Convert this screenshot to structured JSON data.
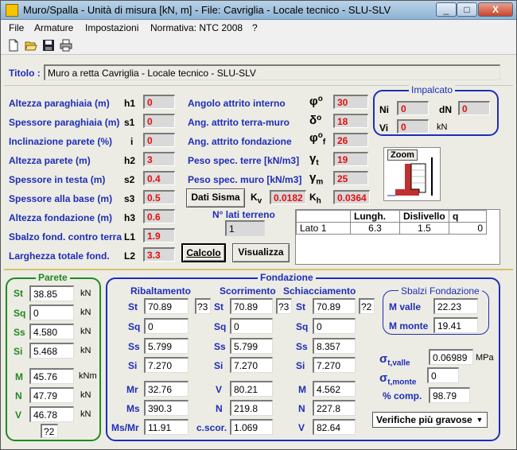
{
  "window": {
    "title": "Muro/Spalla - Unità di misura [kN, m] - File: Cavriglia - Locale tecnico - SLU-SLV",
    "min": "_",
    "max": "□",
    "close": "X"
  },
  "menu": {
    "file": "File",
    "armature": "Armature",
    "impostazioni": "Impostazioni",
    "normativa": "Normativa: NTC 2008",
    "help": "?"
  },
  "toolbar": {
    "icons": [
      "new-icon",
      "open-icon",
      "save-icon",
      "print-icon"
    ]
  },
  "titolo": {
    "label": "Titolo :",
    "value": "Muro a retta Cavriglia - Locale tecnico - SLU-SLV"
  },
  "geom": [
    {
      "label": "Altezza paraghiaia (m)",
      "sym": "h1",
      "value": "0"
    },
    {
      "label": "Spessore paraghiaia (m)",
      "sym": "s1",
      "value": "0"
    },
    {
      "label": "Inclinazione parete (%)",
      "sym": "i",
      "value": "0"
    },
    {
      "label": "Altezza parete (m)",
      "sym": "h2",
      "value": "3"
    },
    {
      "label": "Spessore in testa (m)",
      "sym": "s2",
      "value": "0.4"
    },
    {
      "label": "Spessore alla base (m)",
      "sym": "s3",
      "value": "0.5"
    },
    {
      "label": "Altezza fondazione (m)",
      "sym": "h3",
      "value": "0.6"
    },
    {
      "label": "Sbalzo fond. contro terra",
      "sym": "L1",
      "value": "1.9"
    },
    {
      "label": "Larghezza totale fond.",
      "sym": "L2",
      "value": "3.3"
    }
  ],
  "soil": [
    {
      "label": "Angolo attrito interno",
      "sym": "φ",
      "sup": "o",
      "sub": "",
      "value": "30"
    },
    {
      "label": "Ang. attrito terra-muro",
      "sym": "δ",
      "sup": "o",
      "sub": "",
      "value": "18"
    },
    {
      "label": "Ang. attrito fondazione",
      "sym": "φ",
      "sup": "o",
      "sub": "f",
      "value": "26"
    },
    {
      "label": "Peso spec. terre [kN/m3]",
      "sym": "γ",
      "sup": "",
      "sub": "t",
      "value": "19"
    },
    {
      "label": "Peso spec. muro [kN/m3]",
      "sym": "γ",
      "sup": "",
      "sub": "m",
      "value": "25"
    }
  ],
  "sisma": {
    "button": "Dati Sisma",
    "kv_label": "K",
    "kv_sub": "v",
    "kv": "0.0182",
    "kh_label": "K",
    "kh_sub": "h",
    "kh": "0.0364"
  },
  "impalcato": {
    "title": "Impalcato",
    "ni_label": "Ni",
    "ni": "0",
    "dn_label": "dN",
    "dn": "0",
    "vi_label": "Vi",
    "vi": "0",
    "unit": "kN"
  },
  "zoom": {
    "label": "Zoom"
  },
  "lati": {
    "label": "N° lati terreno",
    "value": "1",
    "headers": [
      "",
      "Lungh.",
      "Dislivello",
      "q"
    ],
    "row": [
      "Lato 1",
      "6.3",
      "1.5",
      "0"
    ]
  },
  "buttons": {
    "calcolo": "Calcolo",
    "visualizza": "Visualizza"
  },
  "parete": {
    "title": "Parete",
    "rows": [
      {
        "label": "St",
        "value": "38.85",
        "unit": "kN"
      },
      {
        "label": "Sq",
        "value": "0",
        "unit": "kN"
      },
      {
        "label": "Ss",
        "value": "4.580",
        "unit": "kN"
      },
      {
        "label": "Si",
        "value": "5.468",
        "unit": "kN"
      },
      {
        "label": "M",
        "value": "45.76",
        "unit": "kNm"
      },
      {
        "label": "N",
        "value": "47.79",
        "unit": "kN"
      },
      {
        "label": "V",
        "value": "46.78",
        "unit": "kN"
      }
    ],
    "extra": "?2"
  },
  "fondazione": {
    "title": "Fondazione",
    "ribaltamento": {
      "title": "Ribaltamento",
      "st": "70.89",
      "st_flag": "?3",
      "sq": "0",
      "ss": "5.799",
      "si": "7.270",
      "mr": "32.76",
      "ms": "390.3",
      "msmr": "11.91"
    },
    "scorrimento": {
      "title": "Scorrimento",
      "st": "70.89",
      "st_flag": "?3",
      "sq": "0",
      "ss": "5.799",
      "si": "7.270",
      "v": "80.21",
      "n": "219.8",
      "cscor": "1.069"
    },
    "schiacciamento": {
      "title": "Schiacciamento",
      "st": "70.89",
      "st_flag": "?2",
      "sq": "0",
      "ss": "8.357",
      "si": "7.270",
      "m": "4.562",
      "n": "227.8",
      "v": "82.64"
    },
    "labels": {
      "st": "St",
      "sq": "Sq",
      "ss": "Ss",
      "si": "Si",
      "mr": "Mr",
      "ms": "Ms",
      "msmr": "Ms/Mr",
      "v": "V",
      "n": "N",
      "cscor": "c.scor.",
      "m": "M"
    }
  },
  "sbalzi": {
    "title": "Sbalzi Fondazione",
    "mvalle_label": "M valle",
    "mvalle": "22.23",
    "mmonte_label": "M monte",
    "mmonte": "19.41"
  },
  "tensioni": {
    "sigma": "σ",
    "tvalle_label": "t,valle",
    "tvalle": "0.06989",
    "tvalle_unit": "MPa",
    "tmonte_label": "t,monte",
    "tmonte": "0",
    "comp_label": "% comp.",
    "comp": "98.79"
  },
  "verifiche": {
    "selected": "Verifiche più gravose"
  },
  "colors": {
    "label_blue": "#1f2db8",
    "red_value": "#e01010",
    "green_border": "#1f8a1f",
    "blue_border": "#1f2db8",
    "gold_divider": "#d6c070"
  }
}
